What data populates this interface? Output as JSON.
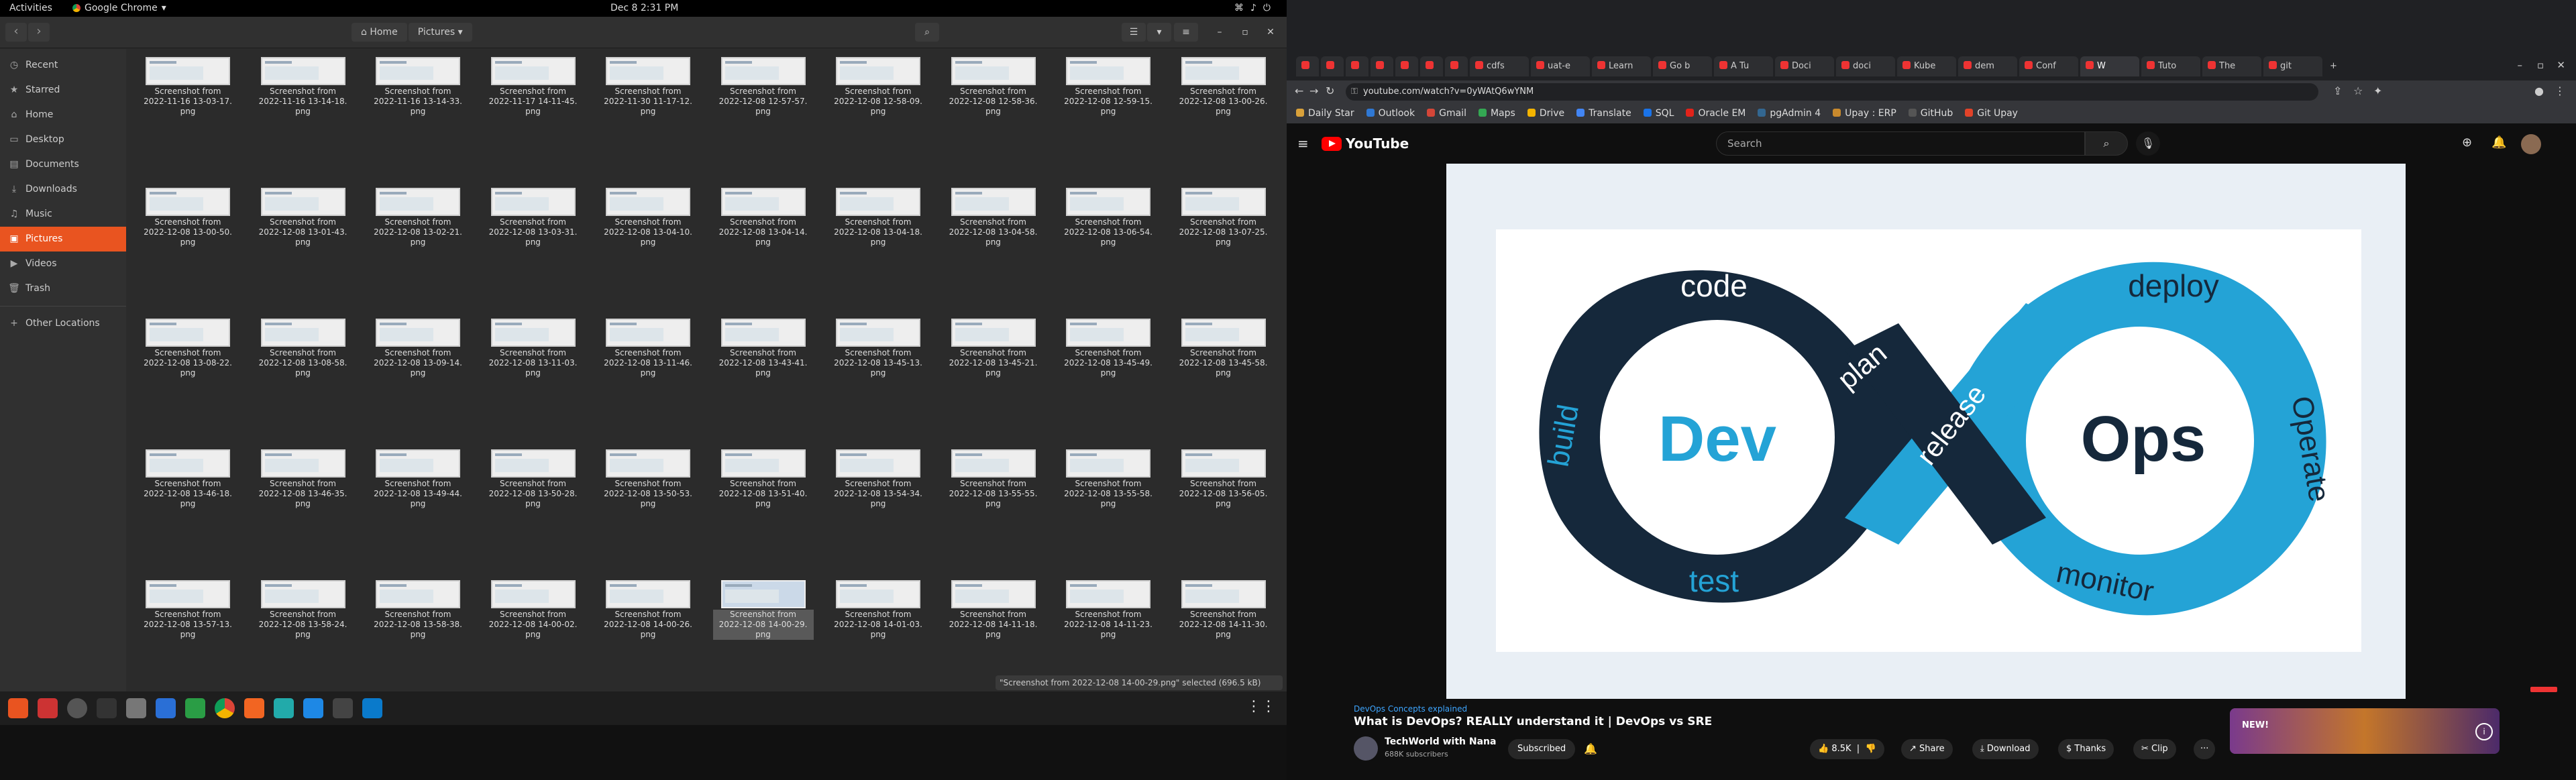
{
  "topbar": {
    "activities": "Activities",
    "app_name": "Google Chrome",
    "clock": "Dec 8  2:31 PM"
  },
  "files": {
    "path": {
      "home": "Home",
      "current": "Pictures"
    },
    "sidebar": [
      {
        "label": "Recent",
        "icon": "clock-icon"
      },
      {
        "label": "Starred",
        "icon": "star-icon"
      },
      {
        "label": "Home",
        "icon": "home-icon"
      },
      {
        "label": "Desktop",
        "icon": "desktop-icon"
      },
      {
        "label": "Documents",
        "icon": "document-icon"
      },
      {
        "label": "Downloads",
        "icon": "download-icon"
      },
      {
        "label": "Music",
        "icon": "music-icon"
      },
      {
        "label": "Pictures",
        "icon": "picture-icon",
        "active": true
      },
      {
        "label": "Videos",
        "icon": "video-icon"
      },
      {
        "label": "Trash",
        "icon": "trash-icon"
      },
      {
        "label": "Other Locations",
        "icon": "plus-icon"
      }
    ],
    "items": [
      [
        "Screenshot from",
        "2022-11-16 13-03-17.",
        "png"
      ],
      [
        "Screenshot from",
        "2022-11-16 13-14-18.",
        "png"
      ],
      [
        "Screenshot from",
        "2022-11-16 13-14-33.",
        "png"
      ],
      [
        "Screenshot from",
        "2022-11-17 14-11-45.",
        "png"
      ],
      [
        "Screenshot from",
        "2022-11-30 11-17-12.",
        "png"
      ],
      [
        "Screenshot from",
        "2022-12-08 12-57-57.",
        "png"
      ],
      [
        "Screenshot from",
        "2022-12-08 12-58-09.",
        "png"
      ],
      [
        "Screenshot from",
        "2022-12-08 12-58-36.",
        "png"
      ],
      [
        "Screenshot from",
        "2022-12-08 12-59-15.",
        "png"
      ],
      [
        "Screenshot from",
        "2022-12-08 13-00-26.",
        "png"
      ],
      [
        "Screenshot from",
        "2022-12-08 13-00-50.",
        "png"
      ],
      [
        "Screenshot from",
        "2022-12-08 13-01-43.",
        "png"
      ],
      [
        "Screenshot from",
        "2022-12-08 13-02-21.",
        "png"
      ],
      [
        "Screenshot from",
        "2022-12-08 13-03-31.",
        "png"
      ],
      [
        "Screenshot from",
        "2022-12-08 13-04-10.",
        "png"
      ],
      [
        "Screenshot from",
        "2022-12-08 13-04-14.",
        "png"
      ],
      [
        "Screenshot from",
        "2022-12-08 13-04-18.",
        "png"
      ],
      [
        "Screenshot from",
        "2022-12-08 13-04-58.",
        "png"
      ],
      [
        "Screenshot from",
        "2022-12-08 13-06-54.",
        "png"
      ],
      [
        "Screenshot from",
        "2022-12-08 13-07-25.",
        "png"
      ],
      [
        "Screenshot from",
        "2022-12-08 13-08-22.",
        "png"
      ],
      [
        "Screenshot from",
        "2022-12-08 13-08-58.",
        "png"
      ],
      [
        "Screenshot from",
        "2022-12-08 13-09-14.",
        "png"
      ],
      [
        "Screenshot from",
        "2022-12-08 13-11-03.",
        "png"
      ],
      [
        "Screenshot from",
        "2022-12-08 13-11-46.",
        "png"
      ],
      [
        "Screenshot from",
        "2022-12-08 13-43-41.",
        "png"
      ],
      [
        "Screenshot from",
        "2022-12-08 13-45-13.",
        "png"
      ],
      [
        "Screenshot from",
        "2022-12-08 13-45-21.",
        "png"
      ],
      [
        "Screenshot from",
        "2022-12-08 13-45-49.",
        "png"
      ],
      [
        "Screenshot from",
        "2022-12-08 13-45-58.",
        "png"
      ],
      [
        "Screenshot from",
        "2022-12-08 13-46-18.",
        "png"
      ],
      [
        "Screenshot from",
        "2022-12-08 13-46-35.",
        "png"
      ],
      [
        "Screenshot from",
        "2022-12-08 13-49-44.",
        "png"
      ],
      [
        "Screenshot from",
        "2022-12-08 13-50-28.",
        "png"
      ],
      [
        "Screenshot from",
        "2022-12-08 13-50-53.",
        "png"
      ],
      [
        "Screenshot from",
        "2022-12-08 13-51-40.",
        "png"
      ],
      [
        "Screenshot from",
        "2022-12-08 13-54-34.",
        "png"
      ],
      [
        "Screenshot from",
        "2022-12-08 13-55-55.",
        "png"
      ],
      [
        "Screenshot from",
        "2022-12-08 13-55-58.",
        "png"
      ],
      [
        "Screenshot from",
        "2022-12-08 13-56-05.",
        "png"
      ],
      [
        "Screenshot from",
        "2022-12-08 13-57-13.",
        "png"
      ],
      [
        "Screenshot from",
        "2022-12-08 13-58-24.",
        "png"
      ],
      [
        "Screenshot from",
        "2022-12-08 13-58-38.",
        "png"
      ],
      [
        "Screenshot from",
        "2022-12-08 14-00-02.",
        "png"
      ],
      [
        "Screenshot from",
        "2022-12-08 14-00-26.",
        "png"
      ],
      [
        "Screenshot from",
        "2022-12-08 14-00-29.",
        "png"
      ],
      [
        "Screenshot from",
        "2022-12-08 14-01-03.",
        "png"
      ],
      [
        "Screenshot from",
        "2022-12-08 14-11-18.",
        "png"
      ],
      [
        "Screenshot from",
        "2022-12-08 14-11-23.",
        "png"
      ],
      [
        "Screenshot from",
        "2022-12-08 14-11-30.",
        "png"
      ]
    ],
    "selected_index": 45,
    "status": "\"Screenshot from 2022-12-08 14-00-29.png\" selected (696.5 kB)"
  },
  "chrome": {
    "tabs": [
      "",
      "",
      "",
      "",
      "",
      "",
      "",
      "cdfs",
      "uat-e",
      "Learn",
      "Go b",
      "A Tu",
      "Doci",
      "doci",
      "Kube",
      "dem",
      "Conf",
      "W",
      "Tuto",
      "The",
      "git"
    ],
    "active_tab_index": 17,
    "url": "youtube.com/watch?v=0yWAtQ6wYNM",
    "bookmarks": [
      {
        "label": "Daily Star",
        "color": "#d9a13a"
      },
      {
        "label": "Outlook",
        "color": "#2f78d4"
      },
      {
        "label": "Gmail",
        "color": "#d44638"
      },
      {
        "label": "Maps",
        "color": "#34a853"
      },
      {
        "label": "Drive",
        "color": "#f4b400"
      },
      {
        "label": "Translate",
        "color": "#4285f4"
      },
      {
        "label": "SQL",
        "color": "#1a73e8"
      },
      {
        "label": "Oracle EM",
        "color": "#e2231a"
      },
      {
        "label": "pgAdmin 4",
        "color": "#336791"
      },
      {
        "label": "Upay : ERP",
        "color": "#c98a2d"
      },
      {
        "label": "GitHub",
        "color": "#555"
      },
      {
        "label": "Git Upay",
        "color": "#e24329"
      }
    ]
  },
  "youtube": {
    "logo": "YouTube",
    "search_placeholder": "Search",
    "slide": {
      "code": "code",
      "deploy": "deploy",
      "plan": "plan",
      "release": "release",
      "build": "build",
      "operate": "Operate",
      "dev": "Dev",
      "ops": "Ops",
      "test": "test",
      "monitor": "monitor"
    },
    "hashtags": "DevOps Concepts explained",
    "title": "What is DevOps? REALLY understand it | DevOps vs SRE",
    "channel": "TechWorld with Nana",
    "subscribers": "688K subscribers",
    "subscribe_label": "Subscribed",
    "likes": "8.5K",
    "share": "Share",
    "download": "Download",
    "thanks": "Thanks",
    "clip": "Clip",
    "more": "···",
    "ad_text": "NEW!"
  }
}
